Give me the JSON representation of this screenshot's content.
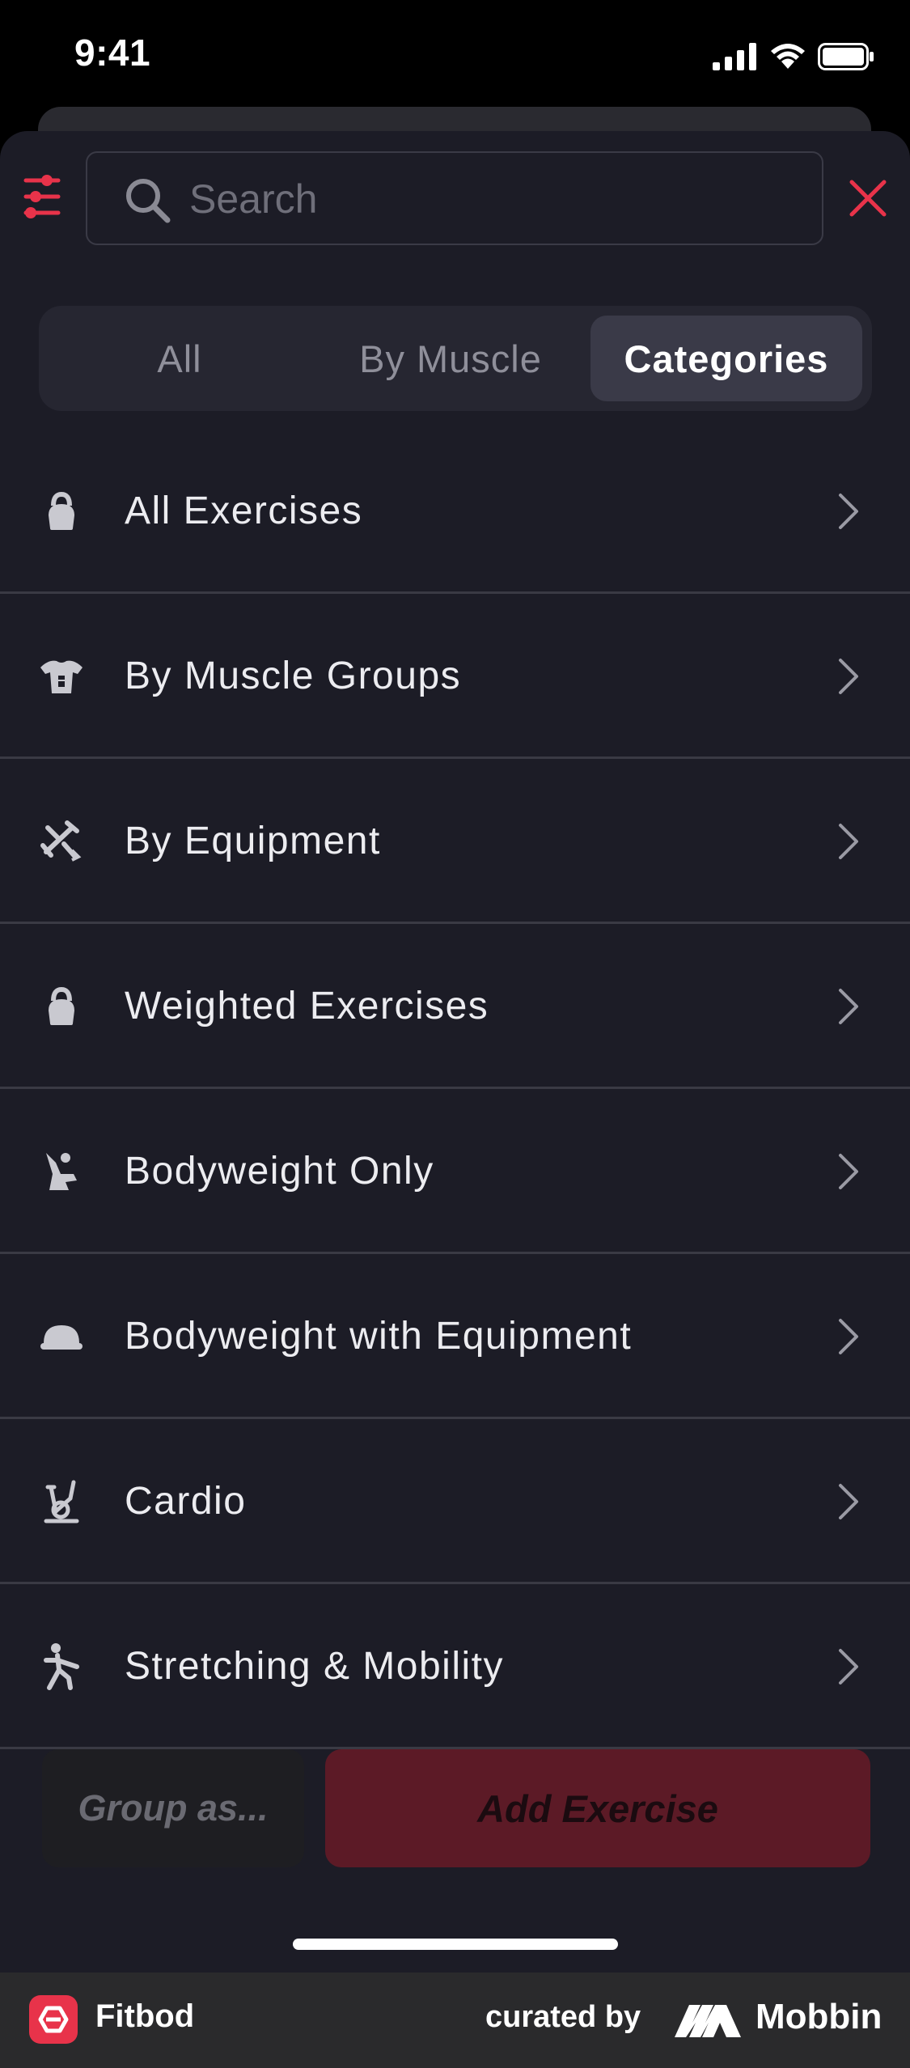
{
  "status_bar": {
    "time": "9:41"
  },
  "search": {
    "placeholder": "Search",
    "value": ""
  },
  "tabs": [
    {
      "label": "All",
      "selected": false
    },
    {
      "label": "By Muscle",
      "selected": false
    },
    {
      "label": "Categories",
      "selected": true
    }
  ],
  "categories": [
    {
      "label": "All Exercises",
      "icon": "kettlebell-icon"
    },
    {
      "label": "By Muscle Groups",
      "icon": "torso-icon"
    },
    {
      "label": "By Equipment",
      "icon": "equipment-icon"
    },
    {
      "label": "Weighted Exercises",
      "icon": "kettlebell-icon"
    },
    {
      "label": "Bodyweight Only",
      "icon": "bodyweight-icon"
    },
    {
      "label": "Bodyweight with Equipment",
      "icon": "bosu-ball-icon"
    },
    {
      "label": "Cardio",
      "icon": "exercise-bike-icon"
    },
    {
      "label": "Stretching & Mobility",
      "icon": "stretching-icon"
    }
  ],
  "actions": {
    "group_label": "Group as...",
    "add_label": "Add Exercise"
  },
  "footer": {
    "app_name": "Fitbod",
    "curated_label": "curated by",
    "brand_name": "Mobbin"
  },
  "colors": {
    "accent": "#e8334a",
    "sheet_bg": "#1c1c26",
    "add_button_bg": "#5c1a26"
  }
}
